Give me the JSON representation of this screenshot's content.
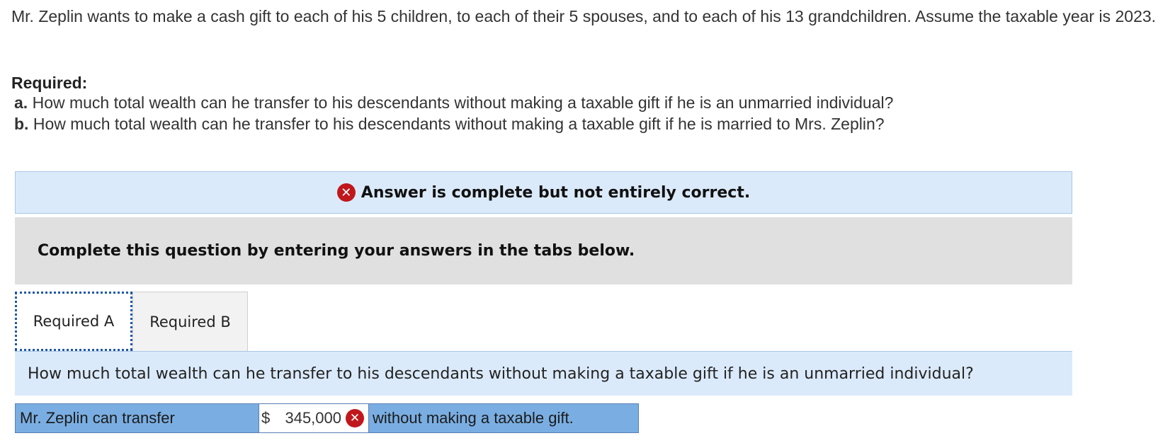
{
  "intro": {
    "text": "Mr. Zeplin wants to make a cash gift to each of his 5 children, to each of their 5 spouses, and to each of his 13 grandchildren. Assume the taxable year is 2023."
  },
  "required": {
    "heading": "Required:",
    "items": [
      {
        "letter": "a.",
        "text": "How much total wealth can he transfer to his descendants without making a taxable gift if he is an unmarried individual?"
      },
      {
        "letter": "b.",
        "text": "How much total wealth can he transfer to his descendants without making a taxable gift if he is married to Mrs. Zeplin?"
      }
    ]
  },
  "status": {
    "icon": "x-icon",
    "text": "Answer is complete but not entirely correct.",
    "color": "#c0171d"
  },
  "instructions": {
    "text": "Complete this question by entering your answers in the tabs below."
  },
  "tabs": [
    {
      "label": "Required A",
      "active": true
    },
    {
      "label": "Required B",
      "active": false
    }
  ],
  "question": {
    "text": "How much total wealth can he transfer to his descendants without making a taxable gift if he is an unmarried individual?"
  },
  "answer": {
    "prefix_label": "Mr. Zeplin can transfer",
    "currency": "$",
    "value": "345,000",
    "status_icon": "x-icon",
    "suffix_label": "without making a taxable gift."
  },
  "colors": {
    "banner_bg": "#dbeafa",
    "instructions_bg": "#e0e0e0",
    "answer_row_bg": "#7aaee2",
    "error_red": "#c0171d"
  }
}
